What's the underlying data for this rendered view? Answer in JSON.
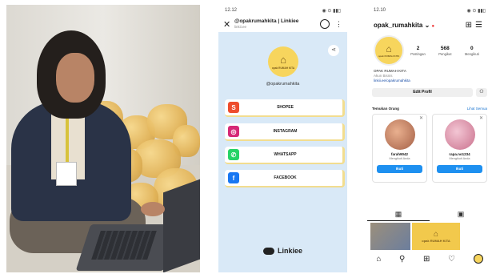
{
  "linkiee": {
    "status_time": "12.12",
    "status_icons": "◉ ⊙ ▮▮▯",
    "title": "@opakrumahkita | Linkiee",
    "subtitle": "linkii.ee",
    "avatar_brand": "opak RUMAH KITA",
    "handle": "@opakrumahkita",
    "links": [
      {
        "label": "SHOPEE",
        "color": "#ee4d2d",
        "glyph": "S"
      },
      {
        "label": "INSTAGRAM",
        "color": "#d62976",
        "glyph": "◎"
      },
      {
        "label": "WHATSAPP",
        "color": "#25d366",
        "glyph": "✆"
      },
      {
        "label": "FACEBOOK",
        "color": "#1877f2",
        "glyph": "f"
      }
    ],
    "footer": "Linkiee"
  },
  "instagram": {
    "status_time": "12.10",
    "status_icons": "◉ ⊙ ▮▮▯",
    "username": "opak_rumahkita",
    "stats": [
      {
        "value": "2",
        "label": "Postingan"
      },
      {
        "value": "568",
        "label": "Pengikut"
      },
      {
        "value": "0",
        "label": "Mengikuti"
      }
    ],
    "bio_name": "OPAK RUMAH KITA",
    "bio_category": "Akun Bisnis",
    "bio_link": "linkii.ee/opakrumahkita",
    "edit_label": "Edit Profil",
    "suggest_title": "Temukan Orang",
    "suggest_all": "Lihat Semua",
    "suggestions": [
      {
        "name": "farah9042",
        "sub": "Mengikuti Anda",
        "follow": "Ikuti",
        "color": "#c9806a"
      },
      {
        "name": "rapa.no1234",
        "sub": "Mengikuti Anda",
        "follow": "Ikuti",
        "color": "#e7a3b8"
      }
    ],
    "post_brand": "opak RUMAH KITA"
  }
}
